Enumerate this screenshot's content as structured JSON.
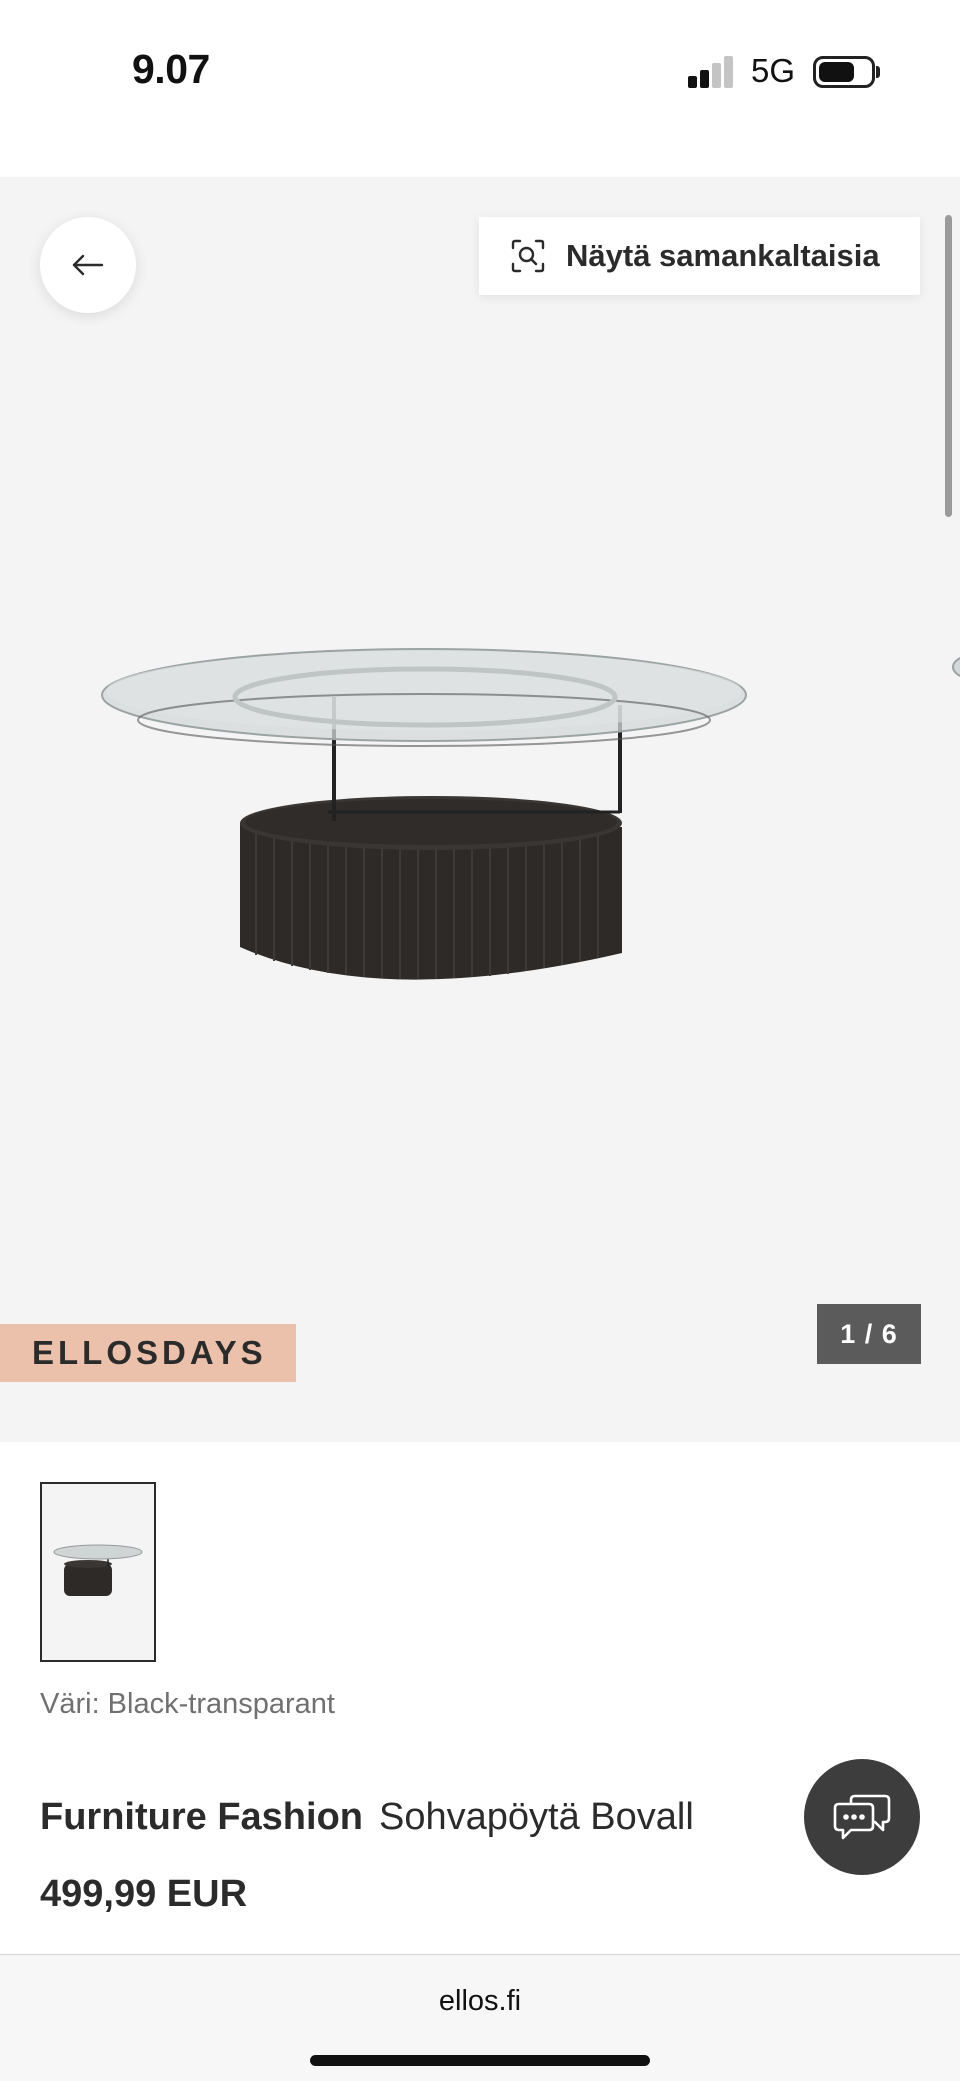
{
  "status_bar": {
    "time": "9.07",
    "network": "5G",
    "signal_bars_active": 2,
    "signal_bars_total": 4,
    "battery_level": 0.7
  },
  "gallery": {
    "back_icon": "arrow-left-icon",
    "similar_button": {
      "icon": "visual-search-icon",
      "label": "Näytä samankaltaisia"
    },
    "promo_badge": "ELLOSDAYS",
    "pager": "1 / 6",
    "current_image": 1,
    "total_images": 6
  },
  "color": {
    "label": "Väri: Black-transparant"
  },
  "product": {
    "brand": "Furniture Fashion",
    "name": "Sohvapöytä Bovall",
    "price": "499,99 EUR"
  },
  "chat": {
    "icon": "chat-bubbles-icon"
  },
  "browser": {
    "url": "ellos.fi"
  },
  "colors": {
    "gallery_background": "#f4f4f4",
    "promo_background": "#ecc1ab",
    "pager_background": "#5b5b5b",
    "chat_background": "#3d3d3d",
    "text_primary": "#2b2b2b",
    "text_secondary": "#707070"
  }
}
